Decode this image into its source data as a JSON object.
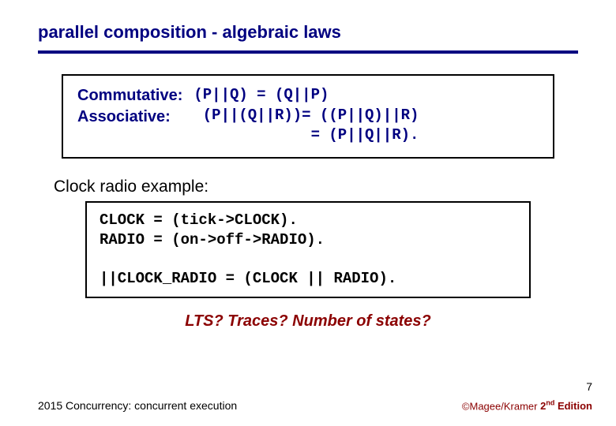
{
  "title": "parallel composition - algebraic laws",
  "laws": {
    "labels": "Commutative:\nAssociative:",
    "rules": "(P||Q) = (Q||P)\n (P||(Q||R))= ((P||Q)||R)\n             = (P||Q||R)."
  },
  "example_label": "Clock radio example:",
  "code": "CLOCK = (tick->CLOCK).\nRADIO = (on->off->RADIO).\n\n||CLOCK_RADIO = (CLOCK || RADIO).",
  "questions": "LTS?   Traces?   Number of states?",
  "page_number": "7",
  "footer_left": "2015  Concurrency: concurrent execution",
  "footer_right_prefix": "©Magee/Kramer ",
  "footer_right_edition_num": "2",
  "footer_right_edition_sup": "nd",
  "footer_right_edition_word": " Edition"
}
